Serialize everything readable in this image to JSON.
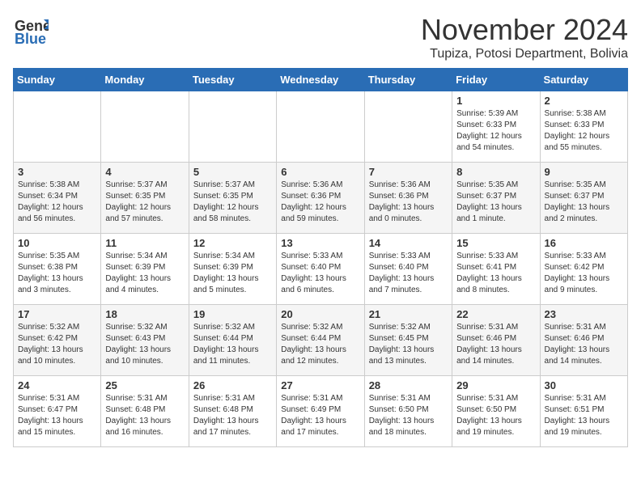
{
  "header": {
    "logo_general": "General",
    "logo_blue": "Blue",
    "month_year": "November 2024",
    "location": "Tupiza, Potosi Department, Bolivia"
  },
  "days_of_week": [
    "Sunday",
    "Monday",
    "Tuesday",
    "Wednesday",
    "Thursday",
    "Friday",
    "Saturday"
  ],
  "weeks": [
    [
      {
        "day": "",
        "info": ""
      },
      {
        "day": "",
        "info": ""
      },
      {
        "day": "",
        "info": ""
      },
      {
        "day": "",
        "info": ""
      },
      {
        "day": "",
        "info": ""
      },
      {
        "day": "1",
        "info": "Sunrise: 5:39 AM\nSunset: 6:33 PM\nDaylight: 12 hours\nand 54 minutes."
      },
      {
        "day": "2",
        "info": "Sunrise: 5:38 AM\nSunset: 6:33 PM\nDaylight: 12 hours\nand 55 minutes."
      }
    ],
    [
      {
        "day": "3",
        "info": "Sunrise: 5:38 AM\nSunset: 6:34 PM\nDaylight: 12 hours\nand 56 minutes."
      },
      {
        "day": "4",
        "info": "Sunrise: 5:37 AM\nSunset: 6:35 PM\nDaylight: 12 hours\nand 57 minutes."
      },
      {
        "day": "5",
        "info": "Sunrise: 5:37 AM\nSunset: 6:35 PM\nDaylight: 12 hours\nand 58 minutes."
      },
      {
        "day": "6",
        "info": "Sunrise: 5:36 AM\nSunset: 6:36 PM\nDaylight: 12 hours\nand 59 minutes."
      },
      {
        "day": "7",
        "info": "Sunrise: 5:36 AM\nSunset: 6:36 PM\nDaylight: 13 hours\nand 0 minutes."
      },
      {
        "day": "8",
        "info": "Sunrise: 5:35 AM\nSunset: 6:37 PM\nDaylight: 13 hours\nand 1 minute."
      },
      {
        "day": "9",
        "info": "Sunrise: 5:35 AM\nSunset: 6:37 PM\nDaylight: 13 hours\nand 2 minutes."
      }
    ],
    [
      {
        "day": "10",
        "info": "Sunrise: 5:35 AM\nSunset: 6:38 PM\nDaylight: 13 hours\nand 3 minutes."
      },
      {
        "day": "11",
        "info": "Sunrise: 5:34 AM\nSunset: 6:39 PM\nDaylight: 13 hours\nand 4 minutes."
      },
      {
        "day": "12",
        "info": "Sunrise: 5:34 AM\nSunset: 6:39 PM\nDaylight: 13 hours\nand 5 minutes."
      },
      {
        "day": "13",
        "info": "Sunrise: 5:33 AM\nSunset: 6:40 PM\nDaylight: 13 hours\nand 6 minutes."
      },
      {
        "day": "14",
        "info": "Sunrise: 5:33 AM\nSunset: 6:40 PM\nDaylight: 13 hours\nand 7 minutes."
      },
      {
        "day": "15",
        "info": "Sunrise: 5:33 AM\nSunset: 6:41 PM\nDaylight: 13 hours\nand 8 minutes."
      },
      {
        "day": "16",
        "info": "Sunrise: 5:33 AM\nSunset: 6:42 PM\nDaylight: 13 hours\nand 9 minutes."
      }
    ],
    [
      {
        "day": "17",
        "info": "Sunrise: 5:32 AM\nSunset: 6:42 PM\nDaylight: 13 hours\nand 10 minutes."
      },
      {
        "day": "18",
        "info": "Sunrise: 5:32 AM\nSunset: 6:43 PM\nDaylight: 13 hours\nand 10 minutes."
      },
      {
        "day": "19",
        "info": "Sunrise: 5:32 AM\nSunset: 6:44 PM\nDaylight: 13 hours\nand 11 minutes."
      },
      {
        "day": "20",
        "info": "Sunrise: 5:32 AM\nSunset: 6:44 PM\nDaylight: 13 hours\nand 12 minutes."
      },
      {
        "day": "21",
        "info": "Sunrise: 5:32 AM\nSunset: 6:45 PM\nDaylight: 13 hours\nand 13 minutes."
      },
      {
        "day": "22",
        "info": "Sunrise: 5:31 AM\nSunset: 6:46 PM\nDaylight: 13 hours\nand 14 minutes."
      },
      {
        "day": "23",
        "info": "Sunrise: 5:31 AM\nSunset: 6:46 PM\nDaylight: 13 hours\nand 14 minutes."
      }
    ],
    [
      {
        "day": "24",
        "info": "Sunrise: 5:31 AM\nSunset: 6:47 PM\nDaylight: 13 hours\nand 15 minutes."
      },
      {
        "day": "25",
        "info": "Sunrise: 5:31 AM\nSunset: 6:48 PM\nDaylight: 13 hours\nand 16 minutes."
      },
      {
        "day": "26",
        "info": "Sunrise: 5:31 AM\nSunset: 6:48 PM\nDaylight: 13 hours\nand 17 minutes."
      },
      {
        "day": "27",
        "info": "Sunrise: 5:31 AM\nSunset: 6:49 PM\nDaylight: 13 hours\nand 17 minutes."
      },
      {
        "day": "28",
        "info": "Sunrise: 5:31 AM\nSunset: 6:50 PM\nDaylight: 13 hours\nand 18 minutes."
      },
      {
        "day": "29",
        "info": "Sunrise: 5:31 AM\nSunset: 6:50 PM\nDaylight: 13 hours\nand 19 minutes."
      },
      {
        "day": "30",
        "info": "Sunrise: 5:31 AM\nSunset: 6:51 PM\nDaylight: 13 hours\nand 19 minutes."
      }
    ]
  ]
}
